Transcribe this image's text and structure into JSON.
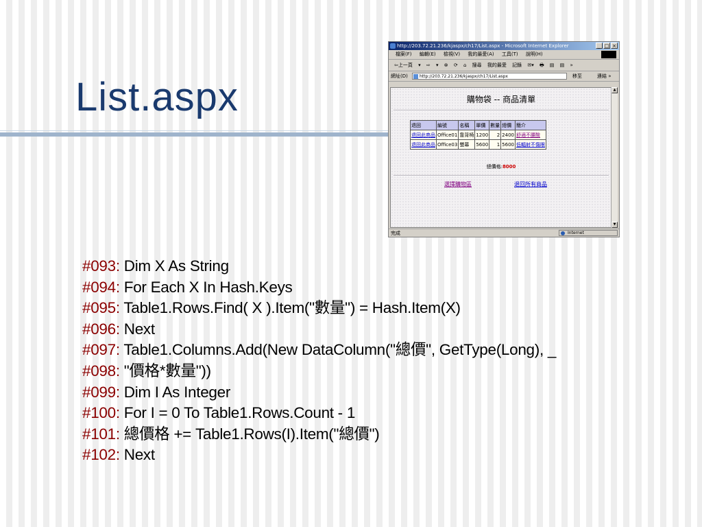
{
  "slide": {
    "title": "List.aspx"
  },
  "browser": {
    "window_title": "http://203.72.21.236/kjaspx/ch17/List.aspx - Microsoft Internet Explorer",
    "window_buttons": [
      "_",
      "□",
      "×"
    ],
    "menu": [
      "檔案(F)",
      "編輯(E)",
      "檢視(V)",
      "我的最愛(A)",
      "工具(T)",
      "說明(H)"
    ],
    "toolbar": [
      "⇦上一頁",
      "▾",
      "⇨",
      "▾",
      "⊗",
      "⟳",
      "⌂",
      "搜尋",
      "我的最愛",
      "記錄",
      "✉▾",
      "🖶",
      "▤",
      "▤",
      "»"
    ],
    "address_label": "網址(D)",
    "address_value": "http://203.72.21.236/kjaspx/ch17/List.aspx",
    "go_label": "移至",
    "links_label": "連結 »",
    "status_text": "完成",
    "status_zone": "Internet",
    "page": {
      "title": "購物袋 -- 商品清單",
      "columns": [
        "退回",
        "編號",
        "名稱",
        "單價",
        "數量",
        "總價",
        "簡介"
      ],
      "rows": [
        [
          "退回此商品",
          "Office01",
          "靠背椅",
          "1200",
          "2",
          "2400",
          "舒適不腰酸"
        ],
        [
          "退回此商品",
          "Office03",
          "螢幕",
          "5600",
          "1",
          "5600",
          "低輻射不傷眼"
        ]
      ],
      "total_label": "總價格:",
      "total_value": "8000",
      "link_select": "選擇購物區",
      "link_return_all": "退回所有商品"
    }
  },
  "code_lines": [
    {
      "num": "#093:",
      "text": "Dim X As String"
    },
    {
      "num": "#094:",
      "text": "For Each X In Hash.Keys"
    },
    {
      "num": "#095:",
      "text": "Table1.Rows.Find( X ).Item(\"數量\") = Hash.Item(X)"
    },
    {
      "num": "#096:",
      "text": "Next"
    },
    {
      "num": "#097:",
      "text": "Table1.Columns.Add(New DataColumn(\"總價\", GetType(Long), _"
    },
    {
      "num": "#098:",
      "text": "\"價格*數量\"))"
    },
    {
      "num": "#099:",
      "text": "Dim I As Integer"
    },
    {
      "num": "#100:",
      "text": "For I = 0 To Table1.Rows.Count - 1"
    },
    {
      "num": "#101:",
      "text": "總價格 += Table1.Rows(I).Item(\"總價\")"
    },
    {
      "num": "#102:",
      "text": "Next"
    }
  ]
}
